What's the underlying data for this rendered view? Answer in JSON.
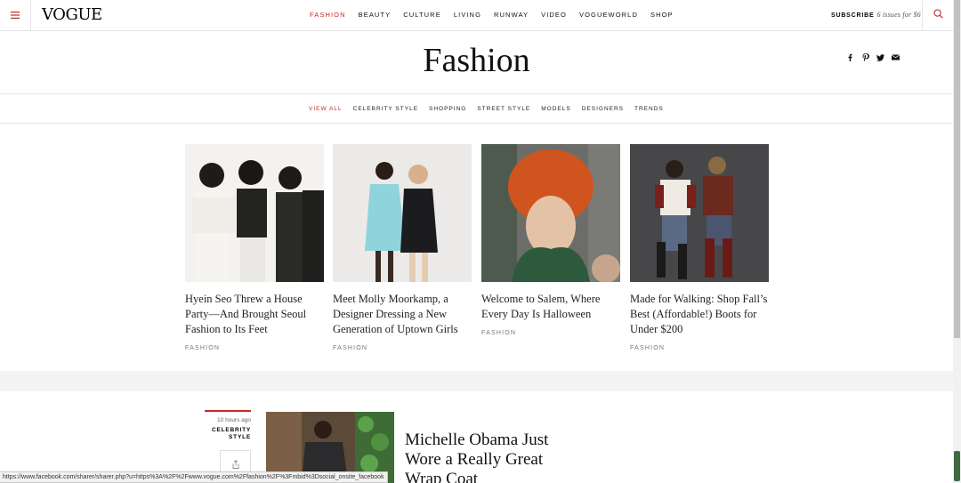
{
  "nav": {
    "logo": "VOGUE",
    "links": [
      "FASHION",
      "BEAUTY",
      "CULTURE",
      "LIVING",
      "RUNWAY",
      "VIDEO",
      "VOGUEWORLD",
      "SHOP"
    ],
    "active": "FASHION",
    "subscribe_label": "SUBSCRIBE",
    "subscribe_offer": "6 issues for $6"
  },
  "page_title": "Fashion",
  "subnav": {
    "links": [
      "VIEW ALL",
      "CELEBRITY STYLE",
      "SHOPPING",
      "STREET STYLE",
      "MODELS",
      "DESIGNERS",
      "TRENDS"
    ],
    "active": "VIEW ALL"
  },
  "cards": [
    {
      "title": "Hyein Seo Threw a House Party—And Brought Seoul Fashion to Its Feet",
      "tag": "FASHION"
    },
    {
      "title": "Meet Molly Moorkamp, a Designer Dressing a New Generation of Uptown Girls",
      "tag": "FASHION"
    },
    {
      "title": "Welcome to Salem, Where Every Day Is Halloween",
      "tag": "FASHION"
    },
    {
      "title": "Made for Walking: Shop Fall’s Best (Affordable!) Boots for Under $200",
      "tag": "FASHION"
    }
  ],
  "story": {
    "time": "10 hours ago",
    "category": "CELEBRITY STYLE",
    "title": "Michelle Obama Just Wore a Really Great Wrap Coat"
  },
  "status_url": "https://www.facebook.com/sharer/sharer.php?u=https%3A%2F%2Fwww.vogue.com%2Ffashion%2F%3Fmbid%3Dsocial_onsite_facebook",
  "colors": {
    "accent": "#c42a25",
    "band": "#f4f4f4"
  }
}
